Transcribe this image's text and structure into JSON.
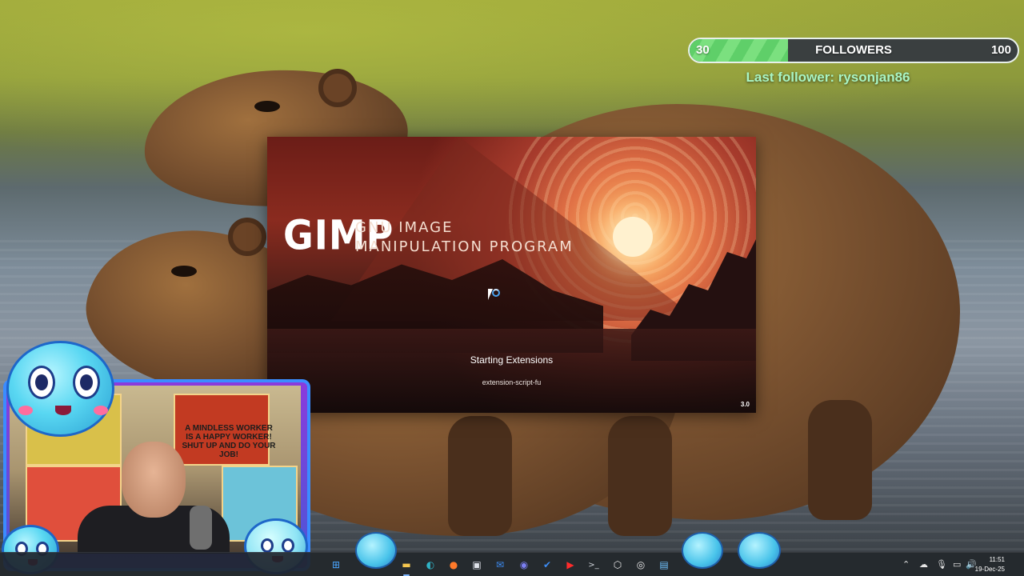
{
  "follower_goal": {
    "current": "30",
    "label": "FOLLOWERS",
    "target": "100",
    "progress": 0.3,
    "last_follower": "Last follower: rysonjan86"
  },
  "splash": {
    "logo": "GIMP",
    "subtitle_line1": "GNU IMAGE",
    "subtitle_line2": "MANIPULATION PROGRAM",
    "status": "Starting Extensions",
    "detail": "extension-script-fu",
    "version": "3.0"
  },
  "webcam": {
    "poster_text": "A MINDLESS WORKER IS A HAPPY WORKER! SHUT UP AND DO YOUR JOB!"
  },
  "taskbar": {
    "icons": [
      {
        "name": "start-icon",
        "glyph": "⊞",
        "color": "#4aa6ff"
      },
      {
        "name": "file-explorer-icon",
        "glyph": "▬",
        "color": "#f4c64f"
      },
      {
        "name": "edge-icon",
        "glyph": "◐",
        "color": "#2fb3c6"
      },
      {
        "name": "firefox-icon",
        "glyph": "●",
        "color": "#ff7a2a"
      },
      {
        "name": "store-icon",
        "glyph": "▣",
        "color": "#dfe3ea"
      },
      {
        "name": "mail-icon",
        "glyph": "✉",
        "color": "#3d8df5"
      },
      {
        "name": "discord-icon",
        "glyph": "◉",
        "color": "#7b7ff2"
      },
      {
        "name": "todo-icon",
        "glyph": "✔",
        "color": "#3d8df5"
      },
      {
        "name": "youtube-icon",
        "glyph": "▶",
        "color": "#ff2b2b"
      },
      {
        "name": "terminal-icon",
        "glyph": ">_",
        "color": "#cfd3da"
      },
      {
        "name": "unity-icon",
        "glyph": "⬡",
        "color": "#e6e6e6"
      },
      {
        "name": "obs-icon",
        "glyph": "◎",
        "color": "#e6e6e6"
      },
      {
        "name": "notepad-icon",
        "glyph": "▤",
        "color": "#6fc2ff"
      }
    ],
    "tray": {
      "chevron": "⌃",
      "cloud": "☁",
      "mic": "🎙",
      "network": "▭",
      "volume": "🔊"
    },
    "time": "11:51",
    "date": "19-Dec-25"
  }
}
